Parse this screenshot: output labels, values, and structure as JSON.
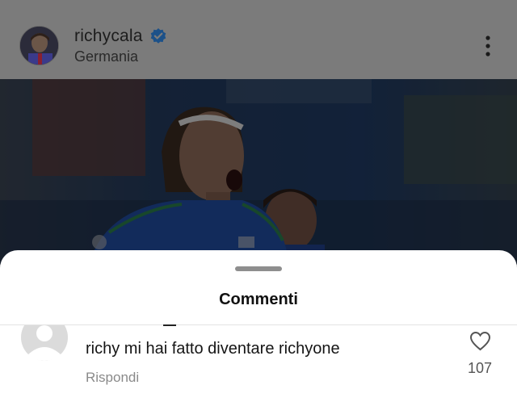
{
  "post": {
    "username": "richycala",
    "location": "Germania",
    "verified_icon": "verified-badge-icon",
    "more_icon": "more-vertical-icon"
  },
  "comments_sheet": {
    "title": "Commenti",
    "comment": {
      "text": "richy mi hai fatto diventare richyone",
      "reply_label": "Rispondi",
      "like_count": "107",
      "like_icon": "heart-outline-icon"
    }
  },
  "colors": {
    "overlay_dim": "#7a7a7a",
    "verified_blue": "#3c86d8",
    "sheet_bg": "#ffffff"
  }
}
